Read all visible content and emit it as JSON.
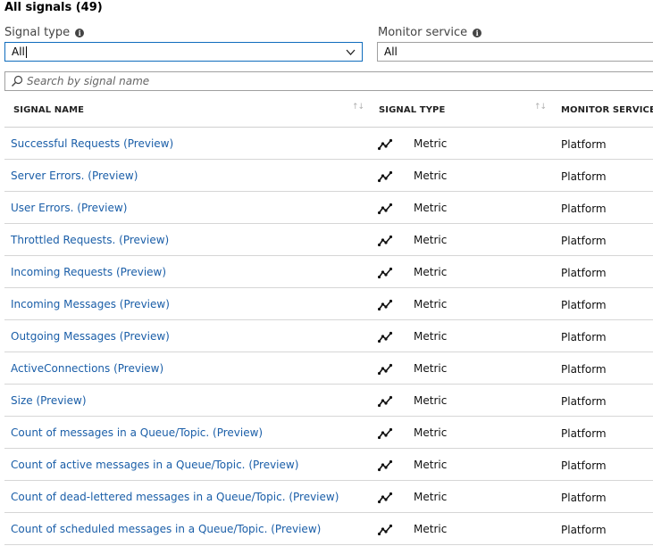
{
  "title": "All signals (49)",
  "filters": {
    "signal_type": {
      "label": "Signal type",
      "value": "All"
    },
    "monitor_service": {
      "label": "Monitor service",
      "value": "All"
    }
  },
  "search": {
    "placeholder": "Search by signal name"
  },
  "table": {
    "columns": {
      "signal_name": "SIGNAL NAME",
      "signal_type": "SIGNAL TYPE",
      "monitor_service": "MONITOR SERVICE"
    },
    "sort_glyph": "↑↓",
    "rows": [
      {
        "name": "Successful Requests (Preview)",
        "type": "Metric",
        "service": "Platform",
        "icon": "metric-icon"
      },
      {
        "name": "Server Errors. (Preview)",
        "type": "Metric",
        "service": "Platform",
        "icon": "metric-icon"
      },
      {
        "name": "User Errors. (Preview)",
        "type": "Metric",
        "service": "Platform",
        "icon": "metric-icon"
      },
      {
        "name": "Throttled Requests. (Preview)",
        "type": "Metric",
        "service": "Platform",
        "icon": "metric-icon"
      },
      {
        "name": "Incoming Requests (Preview)",
        "type": "Metric",
        "service": "Platform",
        "icon": "metric-icon"
      },
      {
        "name": "Incoming Messages (Preview)",
        "type": "Metric",
        "service": "Platform",
        "icon": "metric-icon"
      },
      {
        "name": "Outgoing Messages (Preview)",
        "type": "Metric",
        "service": "Platform",
        "icon": "metric-icon"
      },
      {
        "name": "ActiveConnections (Preview)",
        "type": "Metric",
        "service": "Platform",
        "icon": "metric-icon"
      },
      {
        "name": "Size (Preview)",
        "type": "Metric",
        "service": "Platform",
        "icon": "metric-icon"
      },
      {
        "name": "Count of messages in a Queue/Topic. (Preview)",
        "type": "Metric",
        "service": "Platform",
        "icon": "metric-icon"
      },
      {
        "name": "Count of active messages in a Queue/Topic. (Preview)",
        "type": "Metric",
        "service": "Platform",
        "icon": "metric-icon"
      },
      {
        "name": "Count of dead-lettered messages in a Queue/Topic. (Preview)",
        "type": "Metric",
        "service": "Platform",
        "icon": "metric-icon"
      },
      {
        "name": "Count of scheduled messages in a Queue/Topic. (Preview)",
        "type": "Metric",
        "service": "Platform",
        "icon": "metric-icon"
      }
    ]
  },
  "colors": {
    "link": "#1a5ea8",
    "focus_border": "#0f6cbd"
  }
}
